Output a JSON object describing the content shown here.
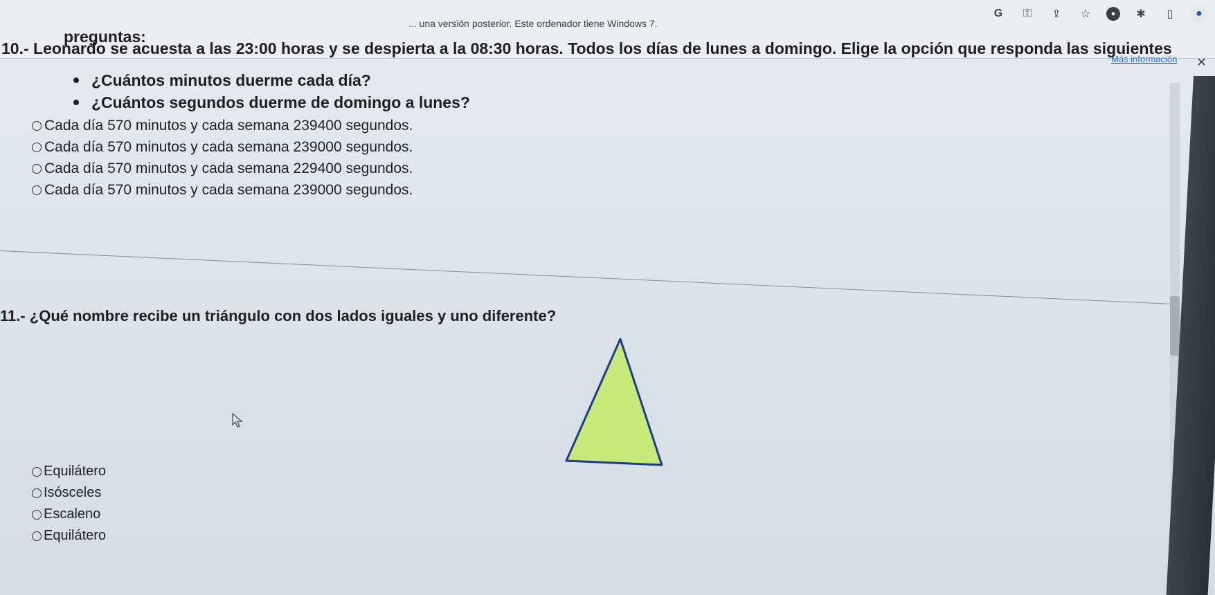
{
  "browser": {
    "notification_text": "... una versión posterior. Este ordenador tiene Windows 7.",
    "more_info_link": "Más información",
    "close_label": "✕",
    "icons": [
      "google-icon",
      "key-icon",
      "share-icon",
      "star-icon",
      "extension-icon",
      "puzzle-icon",
      "window-icon",
      "profile-icon",
      "menu-icon"
    ]
  },
  "question10": {
    "title": "10.- Leonardo se acuesta a las 23:00 horas y se despierta a la 08:30 horas. Todos los días de lunes a domingo. Elige la opción que responda las siguientes",
    "subtitle": "preguntas:",
    "bullets": [
      "¿Cuántos minutos duerme cada día?",
      "¿Cuántos segundos duerme de domingo a lunes?"
    ],
    "options": [
      "Cada día 570 minutos y cada semana 239400 segundos.",
      "Cada día 570 minutos y cada semana 239000 segundos.",
      "Cada día 570 minutos y cada semana 229400 segundos.",
      "Cada día 570 minutos y cada semana 239000 segundos."
    ]
  },
  "question11": {
    "title": "11.- ¿Qué nombre recibe un triángulo con dos lados iguales y uno diferente?",
    "options": [
      "Equilátero",
      "Isósceles",
      "Escaleno",
      "Equilátero"
    ],
    "triangle_fill": "#c6ea7a",
    "triangle_stroke": "#1f3b8a"
  }
}
